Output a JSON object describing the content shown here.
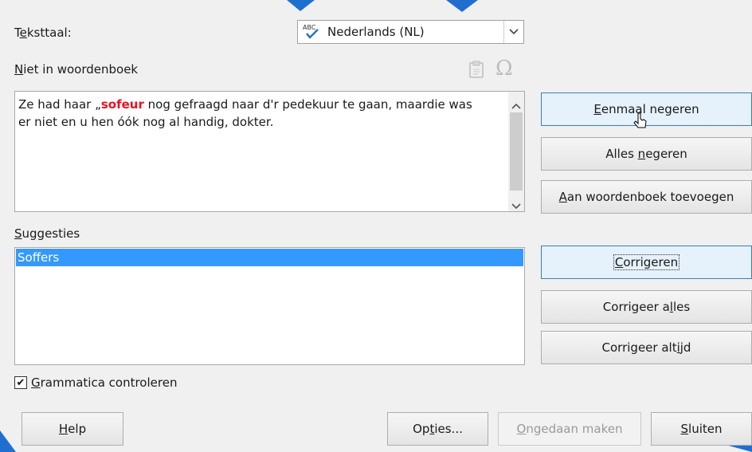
{
  "language": {
    "label_prefix": "T",
    "label_accel": "e",
    "label_suffix": "ksttaal:",
    "value": "Nederlands (NL)",
    "icon_text": "ABC"
  },
  "not_in_dictionary": {
    "label_accel": "N",
    "label_suffix": "iet in woordenboek",
    "text_before": "Ze had haar „",
    "error_word": "sofeur",
    "text_after_line1": " nog gefraagd naar d'r pedekuur te gaan, maardie was",
    "text_line2": "er niet en u hen óók nog al handig, dokter."
  },
  "buttons": {
    "ignore_once": {
      "accel": "E",
      "rest": "enmaal negeren"
    },
    "ignore_all": {
      "pre": "Alles ",
      "accel": "n",
      "rest": "egeren"
    },
    "add_to_dict": {
      "accel": "A",
      "rest": "an woordenboek toevoegen"
    },
    "correct": {
      "accel": "C",
      "rest": "orrigeren"
    },
    "correct_all": {
      "pre": "Corrigeer a",
      "accel": "l",
      "rest": "les"
    },
    "autocorrect": {
      "pre": "Corrigeer alt",
      "accel": "i",
      "rest": "jd"
    }
  },
  "suggestions": {
    "label_accel": "S",
    "label_suffix": "uggesties",
    "items": [
      "Soffers"
    ]
  },
  "grammar": {
    "label_accel": "G",
    "label_suffix": "rammatica controleren",
    "checked": "✔"
  },
  "footer": {
    "help": {
      "accel": "H",
      "rest": "elp"
    },
    "options": {
      "pre": "Op",
      "accel": "t",
      "rest": "ies..."
    },
    "undo": {
      "accel": "O",
      "rest": "ngedaan maken"
    },
    "close": {
      "accel": "S",
      "rest": "luiten"
    }
  },
  "colors": {
    "error_word": "#e81123",
    "selection": "#3399ff",
    "accent_decor": "#1f6fd1"
  },
  "icons": [
    "spellcheck-abc-icon",
    "dropdown-chevron-icon",
    "paste-icon",
    "omega-special-char-icon",
    "scroll-up-icon",
    "scroll-down-icon",
    "checkbox-check-icon",
    "mouse-cursor-icon"
  ]
}
